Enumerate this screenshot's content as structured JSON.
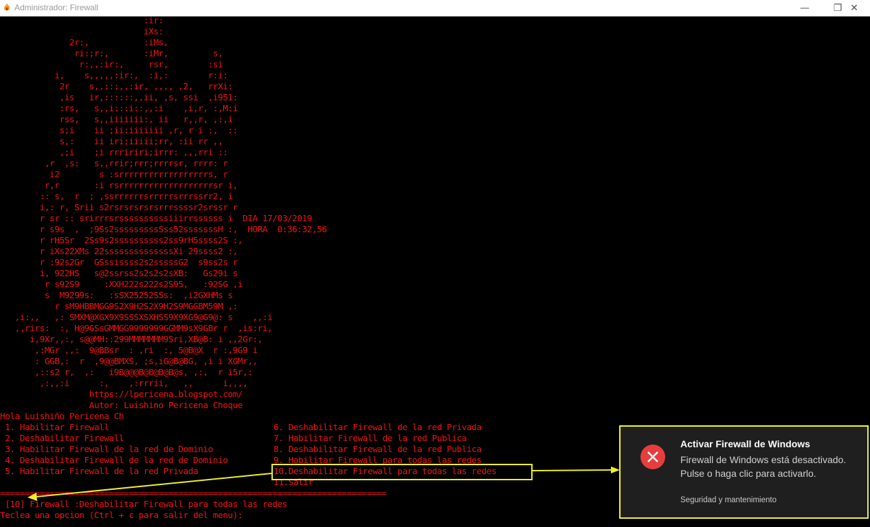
{
  "window": {
    "title": "Administrador:  Firewall",
    "minimize_glyph": "—",
    "maximize_glyph": "❐",
    "close_glyph": "✕"
  },
  "console": {
    "art": [
      "                             :ir:",
      "                             iXs:",
      "              2r:,           :iMs,",
      "               ri:;r:,       :iMr,         s,",
      "                r:,,:ir:,     rsr,        :si",
      "           i,    s,,,,,:ir:,  :i,:        r:i:",
      "            2r    s,,:::,,:ir, ,,,, ,2,   rrXi:",
      "            ,is   ir,::::::,,ii, ,s, ssi  ,i951:",
      "            :rs,   s,,i:::i::,,:i    ,i,r, :,M:i",
      "            rss,   s,,iiiiiii:, ii   r,,r, ,:,i",
      "            s;i    ii ;ii:iiiiiii ,r, r i :,  ::",
      "            s,:    ii iri;iiiii;rr, :ii rr ,,",
      "            ,;i    ;i rrririri;irrr: ,,,rri ::",
      "         ,r  ,s:   s,,rrir;rrr;rrrrsr, rrrr: r",
      "          i2        s :srrrrrrrrrrrrrrrrrrs, r",
      "         r,r       :i rsrrrrrrrrrrrrrrrrrrrsr i,",
      "        :: s,  r  ; ,ssrrrrrrsrrrrrsrrrssrr2, i",
      "        i,: r, Srii s2rsrsrsrsrsrrrssssr2srssr r",
      "        r sr :: srirrrsrssssssssssiiirrssssss i  DIA 17/03/2019",
      "        r s9s  ,  ;9Ss2sssssssssSss52sssssssH :,  HORA  0:36:32,56",
      "        r rH5Sr  2Ss9s2ssssssssss2ss9rH5ssss2S :,",
      "        r iXs22XMs 22ssssssssssssssXi 29ssss2 :,",
      "        r :92s2Gr  GSssissss2s2sssssG2  s9ss2s r",
      "        i, 922HS   s@2ssrss2s2s2s2sXB:   Gs29i s",
      "         r s92S9     :XXH222s222s2S95,   :92SG ,i",
      "         s  M9299s:   :sSX25252S5s:  ,i2GXHMs s",
      "           r sM9HBBMGG9S2X9H2S2X9H2S9MGGBM59M ,:",
      "   ,i:,,   ,: SMXM@XGX9X9SSSXSXHSS9X9XG9@G9@: s    ,,:i",
      "   ,,rirs:  :, H@9GSsGMMGG9999999GGMM9sX9GBr r  ,is:ri,",
      "      i,9Xr,,:, s@@MH::299MMMMMMM9Sri,XB@B: i ,,2Gr:,",
      "       ,:MGr ,,:  9@BBsr  : ,ri  :, 5@B@X  r :,9G9 i",
      "       : GGB,:  r  ,9@@BMXS, ;s,iG@B@BG, ,i i XGMr,,",
      "       ,::s2 r,  ,:   i9B@@@B@B@B@B@s, ,:,  r i5r,:",
      "        ,:,,:i      :,    ,:rrrii,   ,,      i,,,,",
      "                  https://lpericena.blogspot.com/",
      "                  Autor: Luishino Pericena Choque"
    ],
    "greeting": "Hola Luishiño Pericena Ch",
    "menu_left": [
      " 1. Habilitar Firewall",
      " 2. Deshabilitar Firewall",
      " 3. Habilitar Firewall de la red de Dominio",
      " 4. Deshabilitar Firewall de la red de Dominio",
      " 5. Habilitar Firewall de la red Privada"
    ],
    "menu_right": [
      "6. Deshabilitar Firewall de la red Privada",
      "7. Habilitar Firewall de la red Publica",
      "8. Deshabilitar Firewall de la red Publica",
      "9. Habilitar Firewall para todas las redes",
      "10.Deshabilitar Firewall para todas las redes",
      "11.Salir"
    ],
    "separator": "==============================================================================",
    "status_line": " [10] Firewall :Deshabilitar Firewall para todas las redes",
    "prompt_line": "Teclea una opcion (Ctrl + c para salir del menu):"
  },
  "toast": {
    "icon": "error-x-icon",
    "title": "Activar Firewall de Windows",
    "body": "Firewall de Windows está desactivado. Pulse o haga clic para activarlo.",
    "source": "Seguridad y mantenimiento"
  },
  "colors": {
    "console_text": "#ef1414",
    "console_bg": "#000000",
    "annotation": "#f0ef26",
    "toast_bg": "#1f1f1f",
    "toast_icon": "#e63e3e"
  }
}
